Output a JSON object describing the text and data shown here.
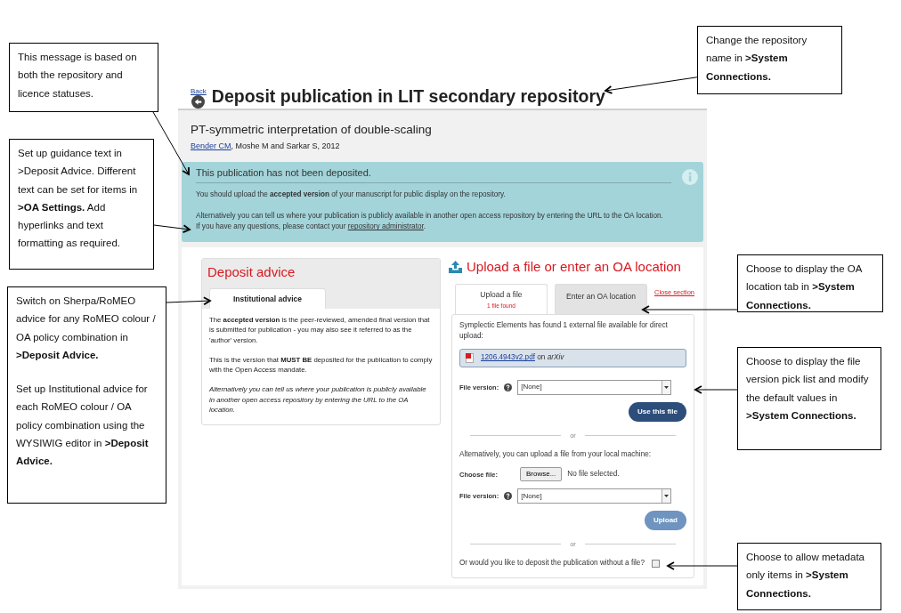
{
  "page": {
    "back_label": "Back",
    "title": "Deposit publication in LIT secondary repository"
  },
  "publication": {
    "title": "PT-symmetric interpretation of double-scaling",
    "author_link": "Bender CM",
    "authors_rest": ", Moshe M and Sarkar S, 2012"
  },
  "status_alert": {
    "heading": "This publication has not been deposited.",
    "paragraphs": [
      "You should upload the **accepted version** of your manuscript for public display on the repository.",
      "Alternatively you can tell us where your publication is publicly available in another open access repository by entering the URL to the OA location."
    ],
    "contact_text": "If you have any questions, please contact your",
    "contact_link": "repository administrator",
    "contact_end": "."
  },
  "deposit_advice": {
    "title": "Deposit advice",
    "tabs": [
      {
        "label": "Institutional advice",
        "selected": true
      }
    ],
    "paragraphs": [
      {
        "text": "The **accepted version** is the peer-reviewed, amended final version that is submitted for publication - you may also see it referred to as the 'author' version.",
        "italic": false
      },
      {
        "text": "This is the version that **MUST BE** deposited for the publication to comply with the Open Access mandate.",
        "italic": false
      },
      {
        "text": "Alternatively you can tell us where your publication is publicly available in another open access repository by entering the URL to the OA location.",
        "italic": true
      }
    ]
  },
  "upload": {
    "title": "Upload a file or enter an OA location",
    "tabs": [
      {
        "label": "Upload a file",
        "sublabel": "1 file found",
        "selected": true
      },
      {
        "label": "Enter an OA location",
        "selected": false
      }
    ],
    "close_link": "Close section",
    "found_text": "Symplectic Elements has found 1 external file available for direct upload:",
    "file": {
      "name": "1206.4943v2.pdf",
      "joiner": "on",
      "source": "arXiv"
    },
    "file_version": {
      "label": "File version:",
      "value": "[None]"
    },
    "use_button": {
      "label": "Use this file",
      "disabled": false
    },
    "divider": "or",
    "local_text": "Alternatively, you can upload a file from your local machine:",
    "choose_label": "Choose file:",
    "browse_button": "Browse...",
    "no_file": "No file selected.",
    "file_version_local": {
      "label": "File version:",
      "value": "[None]"
    },
    "upload_button": {
      "label": "Upload",
      "disabled": true
    },
    "divider_2": "or",
    "no_file_question": "Or would you like to deposit the publication without a file?",
    "no_file_checked": false
  },
  "callouts": [
    {
      "paragraphs": [
        "This message is based on both the repository and licence statuses."
      ]
    },
    {
      "paragraphs": [
        "Set up guidance text in >Deposit Advice. Different text can be set for items in **>OA Settings.** Add hyperlinks and text formatting as required."
      ]
    },
    {
      "paragraphs": [
        "Switch on Sherpa/RoMEO advice  for any RoMEO colour / OA policy combination in **>Deposit Advice.**",
        "Set up Institutional advice for each RoMEO colour / OA policy combination using the WYSIWIG editor in **>Deposit Advice.**"
      ]
    },
    {
      "paragraphs": [
        "Change the repository name in **>System Connections.**"
      ]
    },
    {
      "paragraphs": [
        "Choose to display the OA location tab in **>System Connections.**"
      ]
    },
    {
      "paragraphs": [
        "Choose to display the file version pick list and modify the default values in **>System Connections.**"
      ]
    },
    {
      "paragraphs": [
        "Choose to allow metadata only items in **>System Connections.**"
      ]
    }
  ]
}
